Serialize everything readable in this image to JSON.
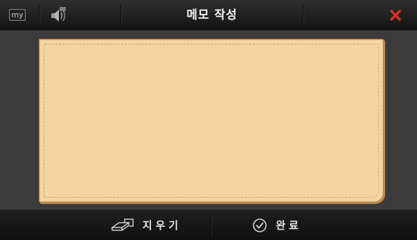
{
  "header": {
    "my_label": "my",
    "title": "메모 작성",
    "icons": {
      "my": "my-icon",
      "sound": "speaker-icon",
      "close": "close-icon"
    },
    "close_color": "#e0301e"
  },
  "memo": {
    "text_value": "",
    "paper_color": "#f3d4a2"
  },
  "footer": {
    "erase_label": "지우기",
    "done_label": "완료",
    "icons": {
      "erase": "eraser-icon",
      "done": "checkmark-circle-icon"
    }
  }
}
